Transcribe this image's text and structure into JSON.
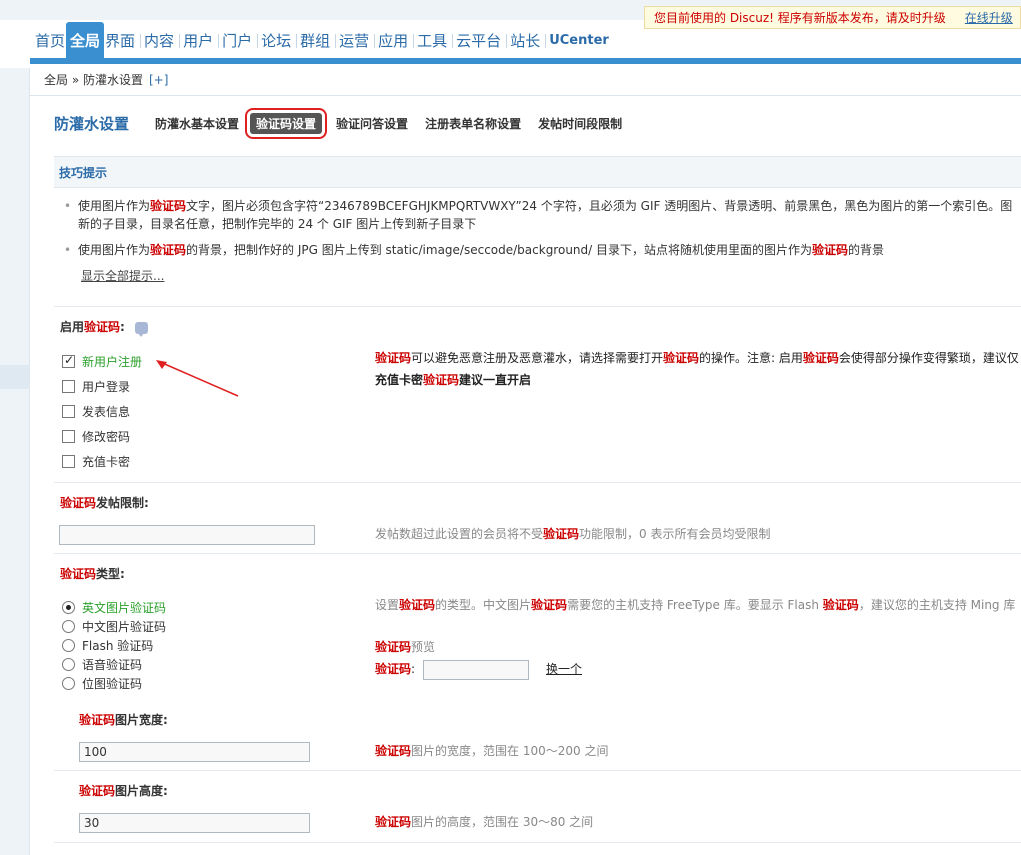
{
  "notice": {
    "text": "您目前使用的 Discuz! 程序有新版本发布，请及时升级",
    "link": "在线升级"
  },
  "nav": {
    "items": [
      {
        "label": "首页",
        "active": false
      },
      {
        "label": "全局",
        "active": true
      },
      {
        "label": "界面",
        "active": false
      },
      {
        "label": "内容",
        "active": false
      },
      {
        "label": "用户",
        "active": false
      },
      {
        "label": "门户",
        "active": false
      },
      {
        "label": "论坛",
        "active": false
      },
      {
        "label": "群组",
        "active": false
      },
      {
        "label": "运营",
        "active": false
      },
      {
        "label": "应用",
        "active": false
      },
      {
        "label": "工具",
        "active": false
      },
      {
        "label": "云平台",
        "active": false
      },
      {
        "label": "站长",
        "active": false
      },
      {
        "label": "UCenter",
        "active": false
      }
    ]
  },
  "breadcrumb": {
    "path": "全局 » 防灌水设置",
    "plus": "[+]"
  },
  "subnav": {
    "title": "防灌水设置",
    "tabs": [
      {
        "label": "防灌水基本设置",
        "current": false
      },
      {
        "label": "验证码设置",
        "current": true
      },
      {
        "label": "验证问答设置",
        "current": false
      },
      {
        "label": "注册表单名称设置",
        "current": false
      },
      {
        "label": "发帖时间段限制",
        "current": false
      }
    ]
  },
  "tips": {
    "heading": "技巧提示",
    "items": [
      {
        "pre": "使用图片作为",
        "key": "验证码",
        "post": "文字，图片必须包含字符“2346789BCEFGHJKMPQRTVWXY”24 个字符，且必须为 GIF 透明图片、背景透明、前景黑色，黑色为图片的第一个索引色。图",
        "line2": "新的子目录，目录名任意，把制作完毕的 24 个 GIF 图片上传到新子目录下"
      },
      {
        "pre": "使用图片作为",
        "key": "验证码",
        "mid": "的背景，把制作好的 JPG 图片上传到 static/image/seccode/background/ 目录下，站点将随机使用里面的图片作为",
        "key2": "验证码",
        "post": "的背景"
      }
    ],
    "show_all": "显示全部提示..."
  },
  "enable": {
    "label_pre": "启用",
    "label_key": "验证码",
    "label_post": ":",
    "options": [
      {
        "label": "新用户注册",
        "checked": true
      },
      {
        "label": "用户登录",
        "checked": false
      },
      {
        "label": "发表信息",
        "checked": false
      },
      {
        "label": "修改密码",
        "checked": false
      },
      {
        "label": "充值卡密",
        "checked": false
      }
    ],
    "desc_key": "验证码",
    "desc_a": "可以避免恶意注册及恶意灌水，请选择需要打开",
    "desc_key2": "验证码",
    "desc_b": "的操作。注意: 启用",
    "desc_key3": "验证码",
    "desc_c": "会使得部分操作变得繁琐，建议仅",
    "desc2_pre": "充值卡密",
    "desc2_key": "验证码",
    "desc2_post": "建议一直开启"
  },
  "post_limit": {
    "label_key": "验证码",
    "label_post": "发帖限制:",
    "value": "",
    "desc_a": "发帖数超过此设置的会员将不受",
    "desc_key": "验证码",
    "desc_b": "功能限制，0 表示所有会员均受限制"
  },
  "type": {
    "label_key": "验证码",
    "label_post": "类型:",
    "options": [
      {
        "label": "英文图片验证码",
        "checked": true
      },
      {
        "label": "中文图片验证码",
        "checked": false
      },
      {
        "label": "Flash 验证码",
        "checked": false
      },
      {
        "label": "语音验证码",
        "checked": false
      },
      {
        "label": "位图验证码",
        "checked": false
      }
    ],
    "desc_a": "设置",
    "desc_key": "验证码",
    "desc_b": "的类型。中文图片",
    "desc_key2": "验证码",
    "desc_c": "需要您的主机支持 FreeType 库。要显示 Flash ",
    "desc_key3": "验证码",
    "desc_d": "，建议您的主机支持 Ming 库",
    "preview_key": "验证码",
    "preview_post": "预览",
    "preview_label_key": "验证码",
    "preview_label_post": ":",
    "refresh": "换一个"
  },
  "width": {
    "label_key": "验证码",
    "label_post": "图片宽度:",
    "value": "100",
    "desc_key": "验证码",
    "desc_post": "图片的宽度，范围在 100～200 之间"
  },
  "height": {
    "label_key": "验证码",
    "label_post": "图片高度:",
    "value": "30",
    "desc_key": "验证码",
    "desc_post": "图片的高度，范围在 30～80 之间"
  },
  "colors": {
    "accent": "#3a8fd0",
    "highlight": "#cc0000",
    "annotation": "#e02020"
  }
}
